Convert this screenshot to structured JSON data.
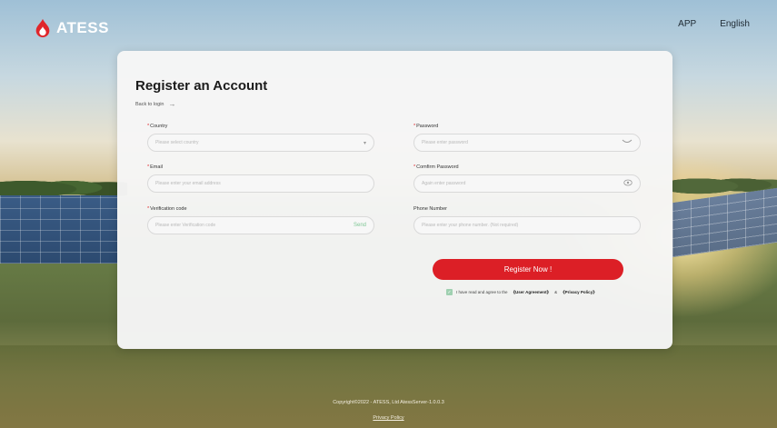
{
  "header": {
    "brand": "ATESS",
    "nav": [
      "APP",
      "English"
    ]
  },
  "form": {
    "title": "Register an Account",
    "back_to_login": "Back to login",
    "fields": {
      "country": {
        "label": "Country",
        "placeholder": "Please select country",
        "required": true
      },
      "email": {
        "label": "Email",
        "placeholder": "Please enter your email address",
        "required": true
      },
      "verification": {
        "label": "Verification code",
        "placeholder": "Please enter Verification code",
        "required": true,
        "action": "Send"
      },
      "password": {
        "label": "Password",
        "placeholder": "Please enter password",
        "required": true
      },
      "confirm_password": {
        "label": "Comfirm Password",
        "placeholder": "Again enter password",
        "required": true
      },
      "phone": {
        "label": "Phone Number",
        "placeholder": "Please enter your phone number. (Not required)",
        "required": false
      }
    },
    "submit_label": "Register Now !",
    "agreement": {
      "checked": true,
      "text": "I have read and agree to the",
      "user_agreement": "《User Agreement》",
      "and": "&",
      "privacy_policy": "《Privacy Policy》"
    }
  },
  "footer": {
    "copyright": "Copyright©2022 - ATESS, Ltd AtessServer-1.0.0.3",
    "privacy_link": "Privacy Policy"
  },
  "colors": {
    "accent": "#dc1f26",
    "send_link": "#7fc795",
    "card_bg": "#f6f6f6"
  }
}
